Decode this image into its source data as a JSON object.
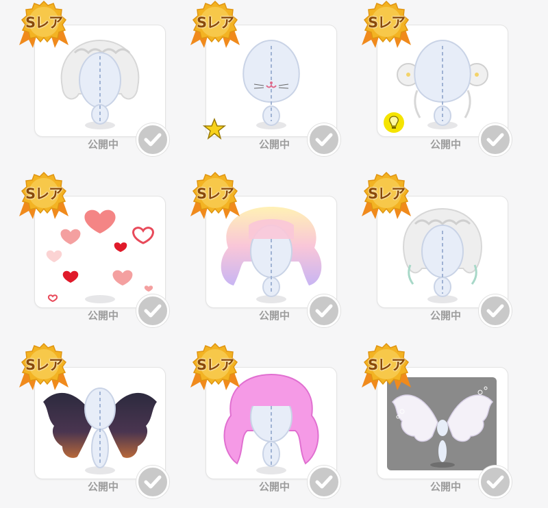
{
  "items": [
    {
      "badge": "Sレア",
      "status": "公開中",
      "art": "wavy-bob-hair",
      "overlay": ""
    },
    {
      "badge": "Sレア",
      "status": "公開中",
      "art": "cat-mouth-face",
      "overlay": "star-icon"
    },
    {
      "badge": "Sレア",
      "status": "公開中",
      "art": "twin-bun-hair",
      "overlay": "lightbulb-icon"
    },
    {
      "badge": "Sレア",
      "status": "公開中",
      "art": "floating-hearts",
      "overlay": ""
    },
    {
      "badge": "Sレア",
      "status": "公開中",
      "art": "pastel-twintail-hair",
      "overlay": ""
    },
    {
      "badge": "Sレア",
      "status": "公開中",
      "art": "braided-bob-hair",
      "overlay": ""
    },
    {
      "badge": "Sレア",
      "status": "公開中",
      "art": "dark-wings",
      "overlay": ""
    },
    {
      "badge": "Sレア",
      "status": "公開中",
      "art": "pink-twintail-hair",
      "overlay": ""
    },
    {
      "badge": "Sレア",
      "status": "公開中",
      "art": "white-angel-wings",
      "overlay": ""
    }
  ],
  "colors": {
    "badge_gold": "#f3b323",
    "badge_ribbon": "#f08a1c",
    "check_bg": "#c9c9c9",
    "status_text": "#9c9c9c"
  }
}
